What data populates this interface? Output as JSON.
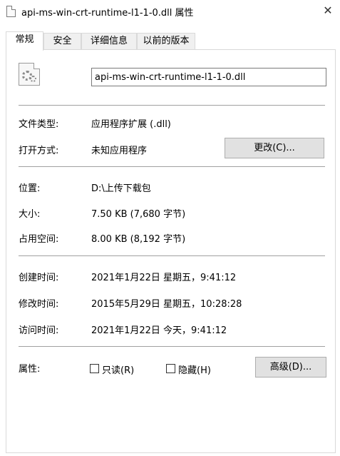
{
  "window": {
    "title": "api-ms-win-crt-runtime-l1-1-0.dll 属性",
    "close_glyph": "✕"
  },
  "tabs": [
    {
      "label": "常规",
      "active": true
    },
    {
      "label": "安全",
      "active": false
    },
    {
      "label": "详细信息",
      "active": false
    },
    {
      "label": "以前的版本",
      "active": false
    }
  ],
  "file": {
    "name": "api-ms-win-crt-runtime-l1-1-0.dll",
    "icon": "dll-gear-icon"
  },
  "type": {
    "label": "文件类型:",
    "value": "应用程序扩展 (.dll)"
  },
  "open_with": {
    "label": "打开方式:",
    "value": "未知应用程序",
    "button": "更改(C)..."
  },
  "location": {
    "label": "位置:",
    "value": "D:\\上传下载包"
  },
  "size": {
    "label": "大小:",
    "value": "7.50 KB (7,680 字节)"
  },
  "size_on_disk": {
    "label": "占用空间:",
    "value": "8.00 KB (8,192 字节)"
  },
  "created": {
    "label": "创建时间:",
    "value": "2021年1月22日 星期五，9:41:12"
  },
  "modified": {
    "label": "修改时间:",
    "value": "2015年5月29日 星期五，10:28:28"
  },
  "accessed": {
    "label": "访问时间:",
    "value": "2021年1月22日 今天，9:41:12"
  },
  "attributes": {
    "label": "属性:",
    "readonly": {
      "label": "只读(R)",
      "checked": false
    },
    "hidden": {
      "label": "隐藏(H)",
      "checked": false
    },
    "advanced_button": "高级(D)..."
  }
}
